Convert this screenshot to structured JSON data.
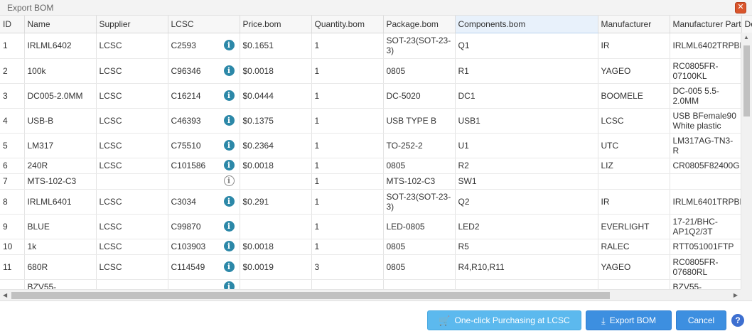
{
  "window": {
    "title": "Export BOM",
    "close_icon": "close-icon"
  },
  "table": {
    "columns": [
      "ID",
      "Name",
      "Supplier",
      "LCSC",
      "Price.bom",
      "Quantity.bom",
      "Package.bom",
      "Components.bom",
      "Manufacturer",
      "Manufacturer Part",
      "De"
    ],
    "rows": [
      [
        "1",
        "IRLML6402",
        "LCSC",
        "C2593",
        "$0.1651",
        "1",
        "SOT-23(SOT-23-3)",
        "Q1",
        "IR",
        "IRLML6402TRPBF",
        ""
      ],
      [
        "2",
        "100k",
        "LCSC",
        "C96346",
        "$0.0018",
        "1",
        "0805",
        "R1",
        "YAGEO",
        "RC0805FR-07100KL",
        ""
      ],
      [
        "3",
        "DC005-2.0MM",
        "LCSC",
        "C16214",
        "$0.0444",
        "1",
        "DC-5020",
        "DC1",
        "BOOMELE",
        "DC-005 5.5-2.0MM",
        ""
      ],
      [
        "4",
        "USB-B",
        "LCSC",
        "C46393",
        "$0.1375",
        "1",
        "USB TYPE B",
        "USB1",
        "LCSC",
        "USB BFemale90 White plastic",
        ""
      ],
      [
        "5",
        "LM317",
        "LCSC",
        "C75510",
        "$0.2364",
        "1",
        "TO-252-2",
        "U1",
        "UTC",
        "LM317AG-TN3-R",
        ""
      ],
      [
        "6",
        "240R",
        "LCSC",
        "C101586",
        "$0.0018",
        "1",
        "0805",
        "R2",
        "LIZ",
        "CR0805F82400G",
        ""
      ],
      [
        "7",
        "MTS-102-C3",
        "",
        "",
        "",
        "1",
        "MTS-102-C3",
        "SW1",
        "",
        "",
        ""
      ],
      [
        "8",
        "IRLML6401",
        "LCSC",
        "C3034",
        "$0.291",
        "1",
        "SOT-23(SOT-23-3)",
        "Q2",
        "IR",
        "IRLML6401TRPBF",
        ""
      ],
      [
        "9",
        "BLUE",
        "LCSC",
        "C99870",
        "",
        "1",
        "LED-0805",
        "LED2",
        "EVERLIGHT",
        "17-21/BHC-AP1Q2/3T",
        ""
      ],
      [
        "10",
        "1k",
        "LCSC",
        "C103903",
        "$0.0018",
        "1",
        "0805",
        "R5",
        "RALEC",
        "RTT051001FTP",
        ""
      ],
      [
        "11",
        "680R",
        "LCSC",
        "C114549",
        "$0.0019",
        "3",
        "0805",
        "R4,R10,R11",
        "YAGEO",
        "RC0805FR-07680RL",
        ""
      ],
      [
        "",
        "BZV55-",
        "",
        "",
        "",
        "",
        "",
        "",
        "",
        "BZV55-",
        ""
      ]
    ],
    "row_info_icon": [
      "info-icon",
      "info-icon",
      "info-icon",
      "info-icon",
      "info-icon",
      "info-icon",
      "info-outline-icon",
      "info-icon",
      "info-icon",
      "info-icon",
      "info-icon",
      "info-icon"
    ]
  },
  "footer": {
    "purchase_label": "One-click Purchasing at LCSC",
    "purchase_icon": "cart-icon",
    "export_label": "Export BOM",
    "export_icon": "download-icon",
    "cancel_label": "Cancel",
    "help_icon": "help-icon",
    "help_glyph": "?"
  },
  "colors": {
    "info_icon": "#2c88a8",
    "purchase_button": "#5cb9ee",
    "primary_button": "#3d8fe0",
    "close_button": "#d9552c",
    "active_header": "#e8f1fb"
  }
}
